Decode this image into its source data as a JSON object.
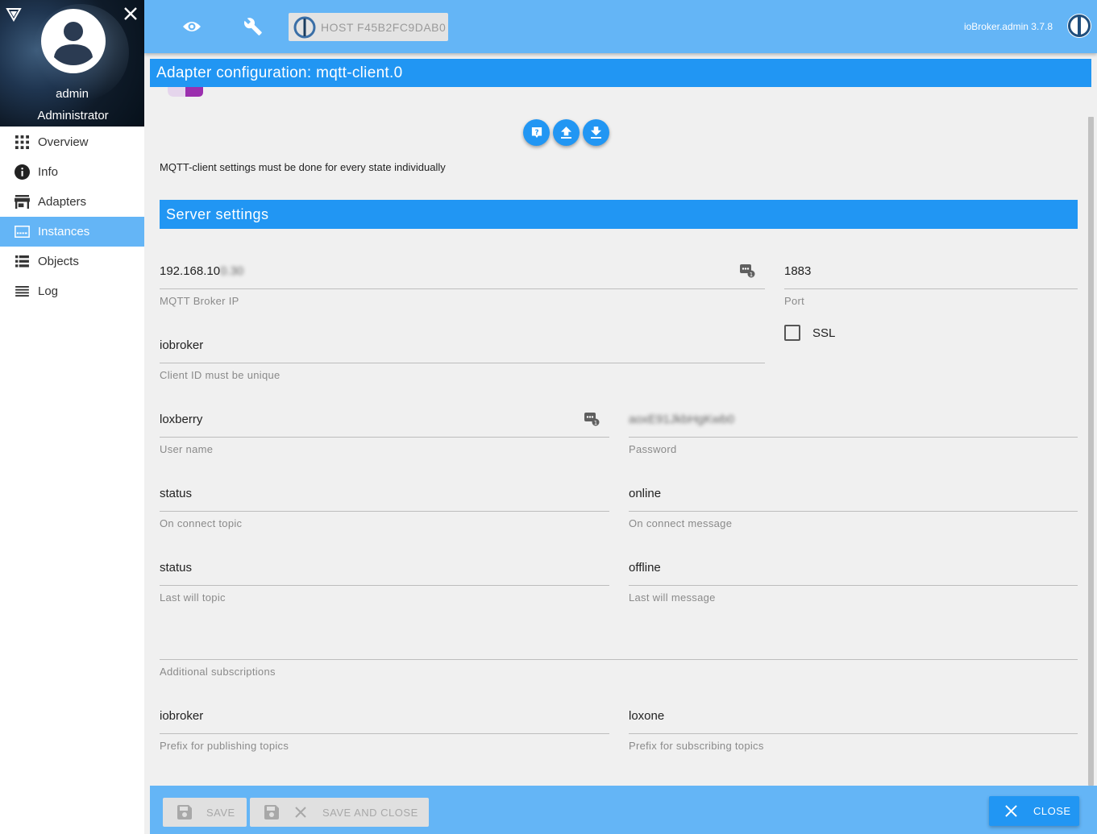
{
  "sidebar": {
    "user": {
      "name": "admin",
      "role": "Administrator"
    },
    "items": [
      {
        "label": "Overview",
        "icon": "grid-icon",
        "active": false
      },
      {
        "label": "Info",
        "icon": "info-icon",
        "active": false
      },
      {
        "label": "Adapters",
        "icon": "store-icon",
        "active": false
      },
      {
        "label": "Instances",
        "icon": "instances-icon",
        "active": true
      },
      {
        "label": "Objects",
        "icon": "list-icon",
        "active": false
      },
      {
        "label": "Log",
        "icon": "lines-icon",
        "active": false
      }
    ]
  },
  "topbar": {
    "host_label": "HOST F45B2FC9DAB0",
    "version": "ioBroker.admin 3.7.8"
  },
  "dialog": {
    "title": "Adapter configuration: mqtt-client.0",
    "info_text": "MQTT-client settings must be done for every state individually",
    "section_title": "Server settings",
    "fields": {
      "broker_ip": {
        "value": "192.168.10",
        "value_blurred": "0.30",
        "label": "MQTT Broker IP"
      },
      "port": {
        "value": "1883",
        "label": "Port"
      },
      "ssl": {
        "label": "SSL",
        "checked": false
      },
      "client_id": {
        "value": "iobroker",
        "label": "Client ID must be unique"
      },
      "user_name": {
        "value": "loxberry",
        "label": "User name"
      },
      "password": {
        "value": "aoxE91JkbHgKwb0",
        "label": "Password"
      },
      "connect_topic": {
        "value": "status",
        "label": "On connect topic"
      },
      "connect_message": {
        "value": "online",
        "label": "On connect message"
      },
      "last_will_topic": {
        "value": "status",
        "label": "Last will topic"
      },
      "last_will_message": {
        "value": "offline",
        "label": "Last will message"
      },
      "additional_subscriptions": {
        "value": "",
        "label": "Additional subscriptions"
      },
      "publish_prefix": {
        "value": "iobroker",
        "label": "Prefix for publishing topics"
      },
      "subscribe_prefix": {
        "value": "loxone",
        "label": "Prefix for subscribing topics"
      }
    }
  },
  "footer": {
    "save_label": "SAVE",
    "save_close_label": "SAVE AND CLOSE",
    "close_label": "CLOSE"
  },
  "colors": {
    "primary": "#2196f3",
    "primary_light": "#64b5f6",
    "background": "#f0f0f0"
  }
}
